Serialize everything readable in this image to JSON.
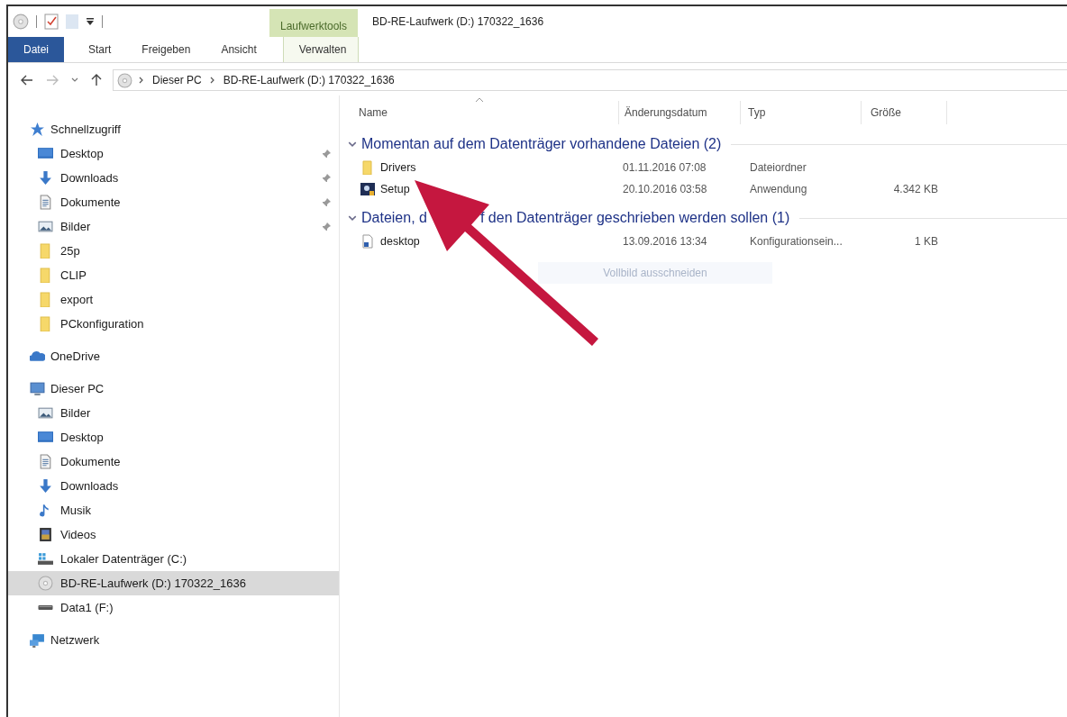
{
  "window": {
    "title": "BD-RE-Laufwerk (D:) 170322_1636"
  },
  "ribbon": {
    "context_group": "Laufwerktools",
    "tabs": [
      {
        "label": "Datei",
        "kind": "file",
        "selected": false
      },
      {
        "label": "Start",
        "kind": "normal",
        "selected": false
      },
      {
        "label": "Freigeben",
        "kind": "normal",
        "selected": false
      },
      {
        "label": "Ansicht",
        "kind": "normal",
        "selected": false
      },
      {
        "label": "Verwalten",
        "kind": "context",
        "selected": false
      }
    ]
  },
  "address_bar": {
    "path": [
      "Dieser PC",
      "BD-RE-Laufwerk (D:) 170322_1636"
    ]
  },
  "navigation": {
    "sections": [
      {
        "label": "Schnellzugriff",
        "kind": "star",
        "children": [
          {
            "label": "Desktop",
            "kind": "desktop",
            "pinned": true,
            "selected": false
          },
          {
            "label": "Downloads",
            "kind": "download",
            "pinned": true,
            "selected": false
          },
          {
            "label": "Dokumente",
            "kind": "document",
            "pinned": true,
            "selected": false
          },
          {
            "label": "Bilder",
            "kind": "pictures",
            "pinned": true,
            "selected": false
          },
          {
            "label": "25p",
            "kind": "folder",
            "pinned": false,
            "selected": false
          },
          {
            "label": "CLIP",
            "kind": "folder",
            "pinned": false,
            "selected": false
          },
          {
            "label": "export",
            "kind": "folder",
            "pinned": false,
            "selected": false
          },
          {
            "label": "PCkonfiguration",
            "kind": "folder",
            "pinned": false,
            "selected": false
          }
        ]
      },
      {
        "label": "OneDrive",
        "kind": "cloud"
      },
      {
        "label": "Dieser PC",
        "kind": "pc",
        "children": [
          {
            "label": "Bilder",
            "kind": "pictures",
            "pinned": false,
            "selected": false
          },
          {
            "label": "Desktop",
            "kind": "desktop",
            "pinned": false,
            "selected": false
          },
          {
            "label": "Dokumente",
            "kind": "document",
            "pinned": false,
            "selected": false
          },
          {
            "label": "Downloads",
            "kind": "download",
            "pinned": false,
            "selected": false
          },
          {
            "label": "Musik",
            "kind": "music",
            "pinned": false,
            "selected": false
          },
          {
            "label": "Videos",
            "kind": "video",
            "pinned": false,
            "selected": false
          },
          {
            "label": "Lokaler Datenträger (C:)",
            "kind": "system_drive",
            "pinned": false,
            "selected": false
          },
          {
            "label": "BD-RE-Laufwerk (D:) 170322_1636",
            "kind": "disc",
            "pinned": false,
            "selected": true
          },
          {
            "label": "Data1 (F:)",
            "kind": "drive",
            "pinned": false,
            "selected": false
          }
        ]
      },
      {
        "label": "Netzwerk",
        "kind": "network"
      }
    ]
  },
  "file_list": {
    "columns": [
      {
        "label": "Name",
        "sorted": true
      },
      {
        "label": "Änderungsdatum",
        "sorted": false
      },
      {
        "label": "Typ",
        "sorted": false
      },
      {
        "label": "Größe",
        "sorted": false
      }
    ],
    "groups": [
      {
        "title_parts": [
          "Momentan auf dem Datenträger vorhandene Dateien (2)"
        ],
        "expanded": true,
        "items": [
          {
            "name": "Drivers",
            "kind": "folder",
            "date": "01.11.2016 07:08",
            "type": "Dateiordner"
          },
          {
            "name": "Setup",
            "kind": "application",
            "date": "20.10.2016 03:58",
            "type": "Anwendung",
            "size": "4.342 KB"
          }
        ]
      },
      {
        "title_parts": [
          "Dateien, d",
          "f den Datenträger geschrieben werden sollen (1)"
        ],
        "expanded": true,
        "items": [
          {
            "name": "desktop",
            "kind": "settings_file",
            "date": "13.09.2016 13:34",
            "type": "Konfigurationsein...",
            "size": "1 KB"
          }
        ]
      }
    ]
  },
  "tooltip": {
    "text": "Vollbild ausschneiden"
  }
}
